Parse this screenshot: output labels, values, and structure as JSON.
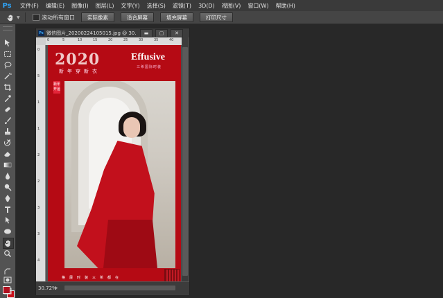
{
  "app": {
    "logo_text": "Ps"
  },
  "menubar": {
    "items": [
      "文件(F)",
      "编辑(E)",
      "图像(I)",
      "图层(L)",
      "文字(Y)",
      "选择(S)",
      "滤镜(T)",
      "3D(D)",
      "视图(V)",
      "窗口(W)",
      "帮助(H)"
    ]
  },
  "options": {
    "checkbox_label": "滚动所有窗口",
    "buttons": [
      "实际像素",
      "适合屏幕",
      "填充屏幕",
      "打印尺寸"
    ]
  },
  "document": {
    "title": "微信图片_20200224105015.jpg @ 30.7%(...",
    "zoom": "30.72%",
    "ruler_h": [
      "0",
      "5",
      "10",
      "15",
      "20",
      "25",
      "30",
      "35",
      "40"
    ],
    "ruler_v": [
      "0",
      "5",
      "1",
      "1",
      "2",
      "2",
      "3",
      "3",
      "4"
    ]
  },
  "poster": {
    "year": "2020",
    "subtitle": "新年穿新衣",
    "brand": "Effusive",
    "brand_sub": "三希国际时装",
    "tag": "新年开运",
    "footer": "格展时装三希都在"
  },
  "colors": {
    "foreground": "#b01120",
    "background": "#c8101a",
    "poster_red": "#b50a14"
  }
}
